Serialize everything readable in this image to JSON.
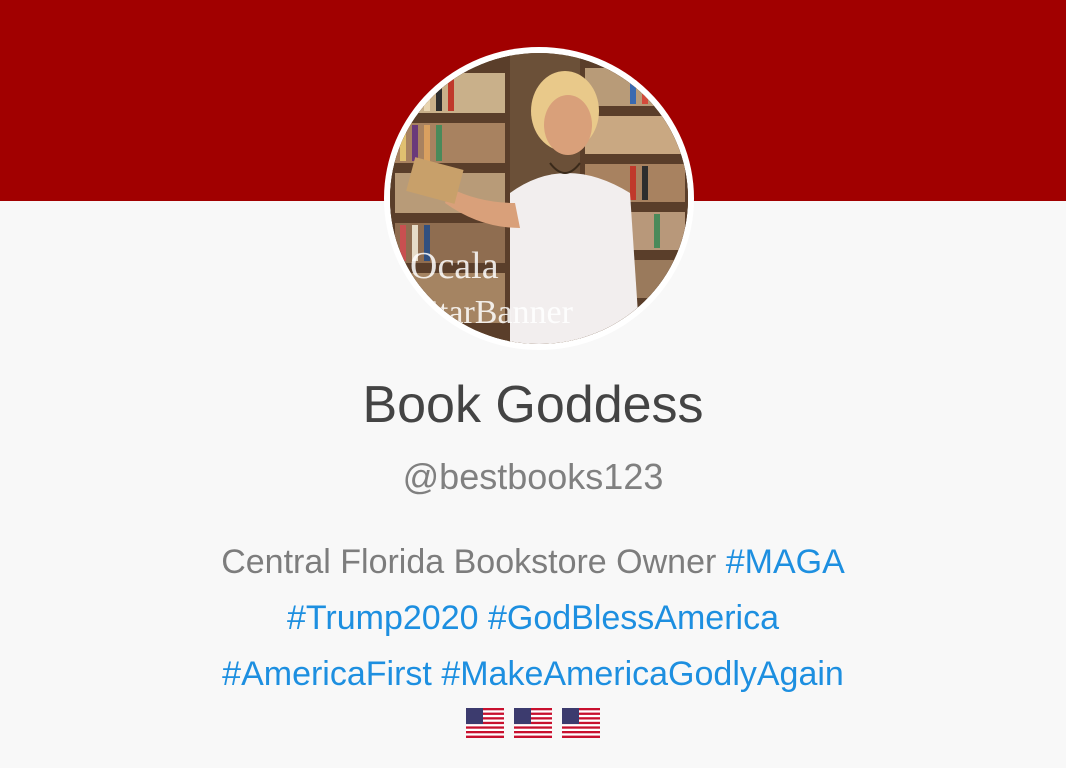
{
  "profile": {
    "display_name": "Book Goddess",
    "handle": "@bestbooks123",
    "avatar_watermark_line1": "Ocala",
    "avatar_watermark_line2": "StarBanner",
    "bio": {
      "text": "Central Florida Bookstore Owner",
      "hashtags": [
        "#MAGA",
        "#Trump2020",
        "#GodBlessAmerica",
        "#AmericaFirst",
        "#MakeAmericaGodlyAgain"
      ],
      "emoji": [
        "us-flag",
        "us-flag",
        "us-flag"
      ]
    }
  },
  "colors": {
    "banner": "#a10000",
    "background": "#f8f8f8",
    "name": "#444444",
    "handle": "#808080",
    "hashtag": "#1d8fe0"
  }
}
